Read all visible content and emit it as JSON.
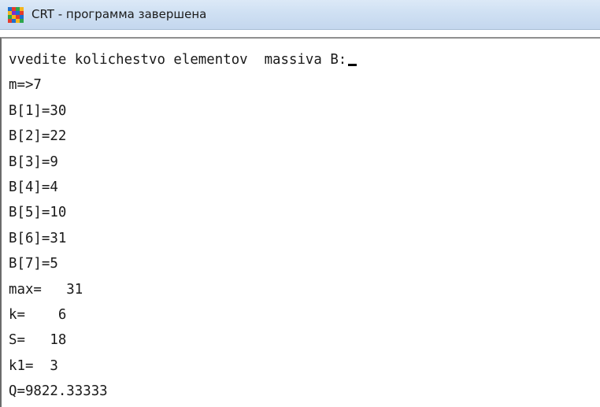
{
  "window": {
    "title": "CRT - программа завершена",
    "icon": "crt-app-icon"
  },
  "console": {
    "prompt_line": "vvedite kolichestvo elementov  massiva B:",
    "lines": [
      "m=>7",
      "B[1]=30",
      "B[2]=22",
      "B[3]=9",
      "B[4]=4",
      "B[5]=10",
      "B[6]=31",
      "B[7]=5",
      "max=   31",
      "k=    6",
      "S=   18",
      "k1=  3",
      "Q=9822.33333"
    ]
  },
  "colors": {
    "titlebar": "#cfe0f3",
    "console_bg": "#ffffff",
    "text": "#1a1a1a"
  }
}
